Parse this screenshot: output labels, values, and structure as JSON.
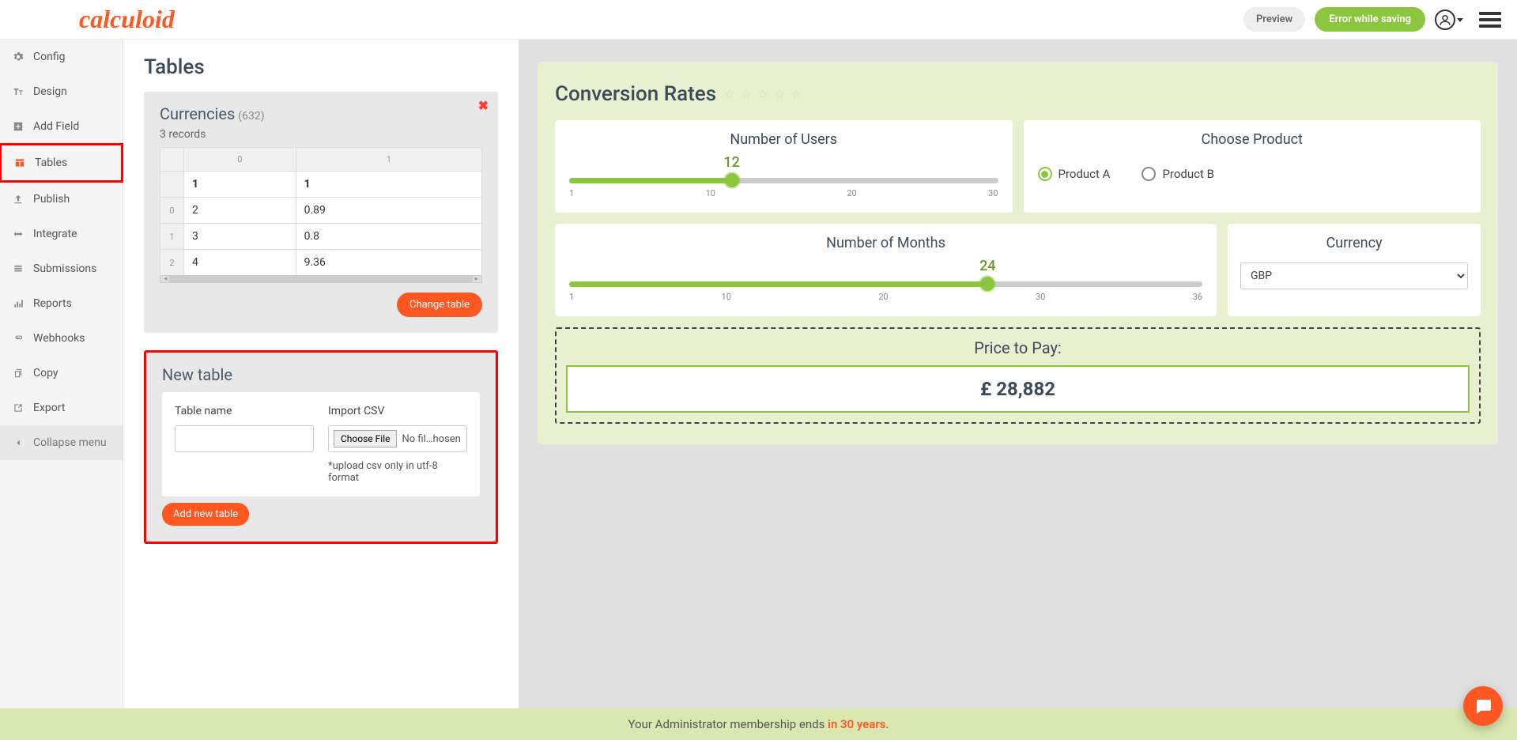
{
  "brand": "calculoid",
  "topbar": {
    "preview": "Preview",
    "error": "Error while saving"
  },
  "sidebar": {
    "items": [
      {
        "icon": "gear",
        "label": "Config"
      },
      {
        "icon": "tt",
        "label": "Design"
      },
      {
        "icon": "plus",
        "label": "Add Field"
      },
      {
        "icon": "table",
        "label": "Tables",
        "active": true
      },
      {
        "icon": "upload",
        "label": "Publish"
      },
      {
        "icon": "arrows",
        "label": "Integrate"
      },
      {
        "icon": "list",
        "label": "Submissions"
      },
      {
        "icon": "bars",
        "label": "Reports"
      },
      {
        "icon": "link",
        "label": "Webhooks"
      },
      {
        "icon": "copy",
        "label": "Copy"
      },
      {
        "icon": "export",
        "label": "Export"
      }
    ],
    "collapse": "Collapse menu"
  },
  "page": {
    "title": "Tables",
    "currencies": {
      "title": "Currencies",
      "count": "(632)",
      "records": "3 records",
      "cols": [
        "0",
        "1"
      ],
      "headers": [
        "1",
        "1"
      ],
      "rows": [
        {
          "idx": "0",
          "c0": "2",
          "c1": "0.89"
        },
        {
          "idx": "1",
          "c0": "3",
          "c1": "0.8"
        },
        {
          "idx": "2",
          "c0": "4",
          "c1": "9.36"
        }
      ],
      "change_btn": "Change table"
    },
    "newtable": {
      "title": "New table",
      "name_label": "Table name",
      "csv_label": "Import CSV",
      "choose_file": "Choose File",
      "no_file": "No fil…hosen",
      "hint": "*upload csv only in utf-8 format",
      "add_btn": "Add new table"
    }
  },
  "preview": {
    "title": "Conversion Rates",
    "users": {
      "title": "Number of Users",
      "value": "12",
      "min": "1",
      "t1": "10",
      "t2": "20",
      "max": "30",
      "percent": 38
    },
    "product": {
      "title": "Choose Product",
      "a": "Product A",
      "b": "Product B"
    },
    "months": {
      "title": "Number of Months",
      "value": "24",
      "min": "1",
      "t1": "10",
      "t2": "20",
      "t3": "30",
      "max": "36",
      "percent": 66
    },
    "currency": {
      "title": "Currency",
      "value": "GBP"
    },
    "price": {
      "label": "Price to Pay:",
      "value": "£ 28,882"
    }
  },
  "footer": {
    "prefix": "Your Administrator membership ends ",
    "highlight": "in 30 years",
    "suffix": "."
  }
}
